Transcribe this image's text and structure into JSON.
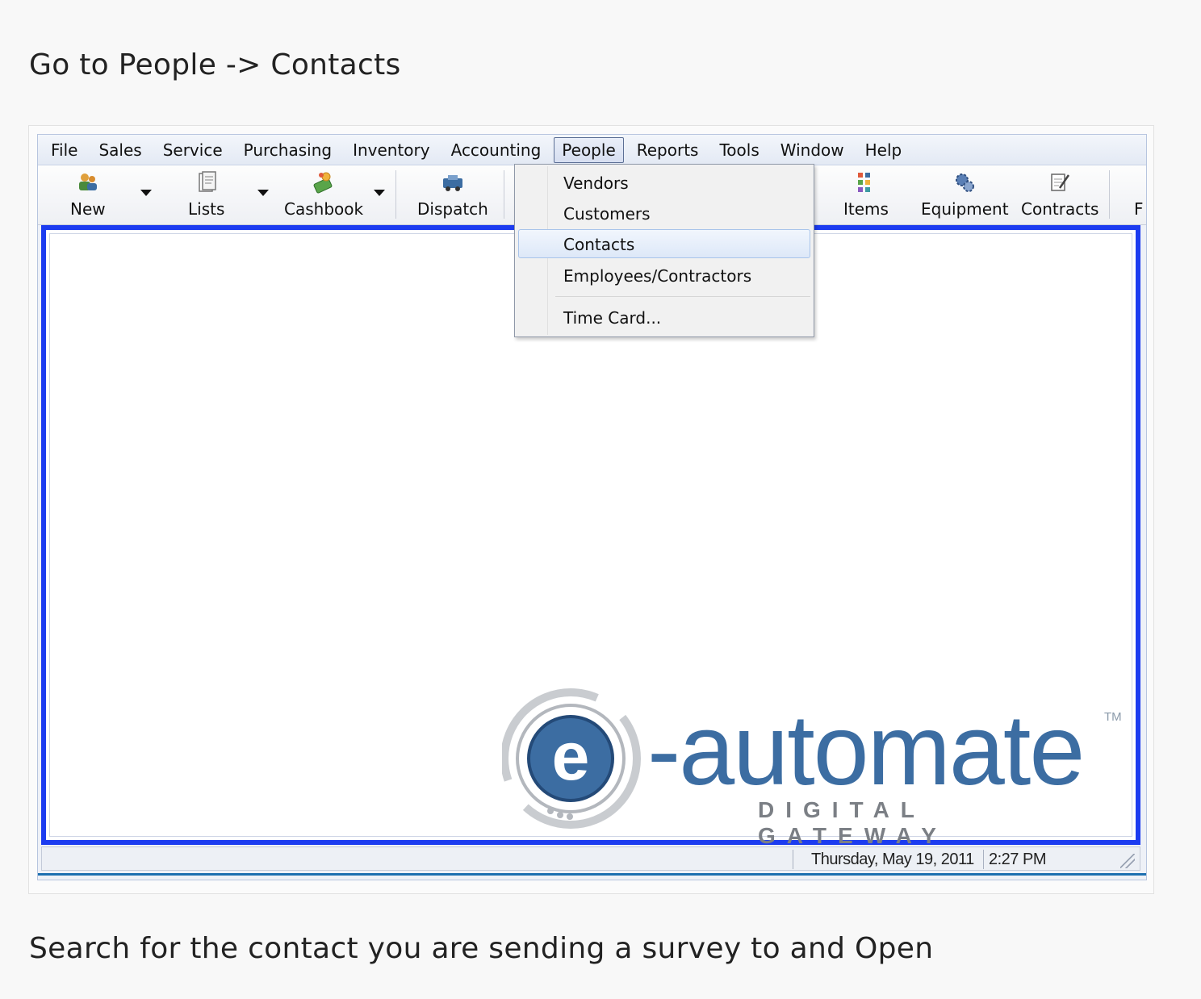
{
  "instructions": {
    "top": "Go to People -> Contacts",
    "bottom": "Search for the contact you are sending a survey to and Open"
  },
  "menubar": {
    "items": [
      "File",
      "Sales",
      "Service",
      "Purchasing",
      "Inventory",
      "Accounting",
      "People",
      "Reports",
      "Tools",
      "Window",
      "Help"
    ],
    "active": "People"
  },
  "toolbar": {
    "new_label": "New",
    "lists_label": "Lists",
    "cashbook_label": "Cashbook",
    "dispatch_label": "Dispatch",
    "items_label": "Items",
    "equipment_label": "Equipment",
    "contracts_label": "Contracts",
    "cut_label": "F"
  },
  "people_menu": {
    "items": [
      "Vendors",
      "Customers",
      "Contacts",
      "Employees/Contractors",
      "Time Card..."
    ],
    "highlighted": "Contacts"
  },
  "logo": {
    "wordmark": "-automate",
    "tm": "TM",
    "tagline": "DIGITAL GATEWAY"
  },
  "statusbar": {
    "date": "Thursday, May 19, 2011",
    "time": "2:27 PM"
  }
}
